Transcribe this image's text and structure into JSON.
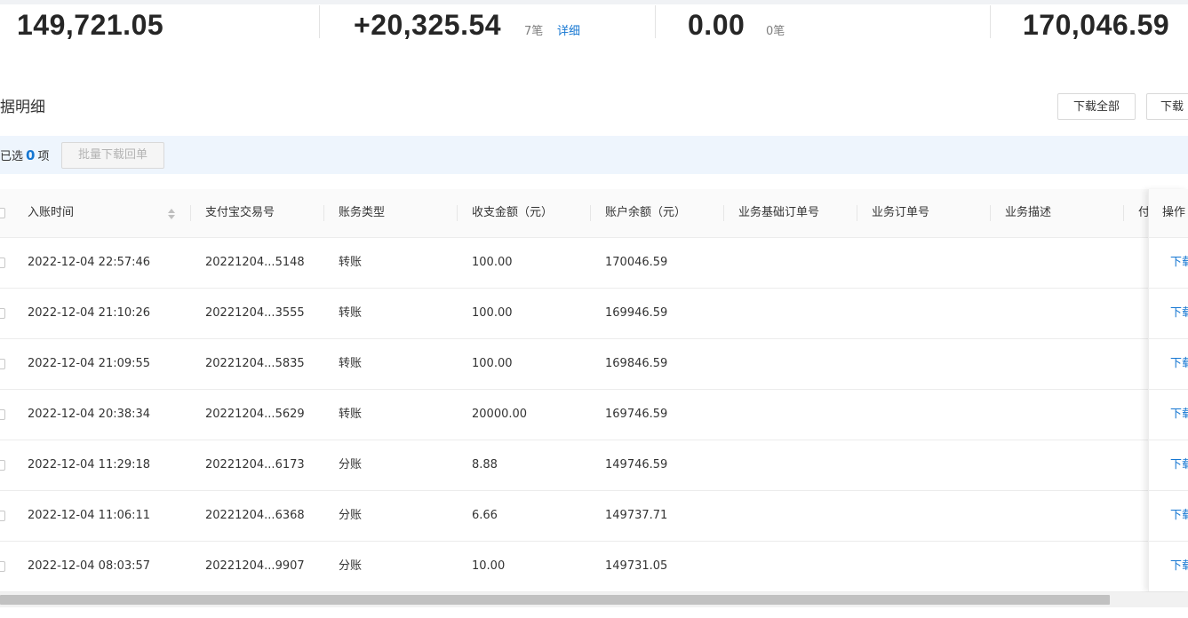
{
  "summary": {
    "stats": [
      {
        "value": "149,721.05"
      },
      {
        "value": "+20,325.54",
        "count": "7笔",
        "link": "详细"
      },
      {
        "value": "0.00",
        "count": "0笔"
      },
      {
        "value": "170,046.59"
      }
    ]
  },
  "section": {
    "title": "据明细",
    "download_all": "下载全部",
    "download_partial": "下载"
  },
  "selection": {
    "prefix": "已选",
    "count": "0",
    "suffix": "项",
    "batch_button": "批量下载回单"
  },
  "table": {
    "columns": [
      "入账时间",
      "支付宝交易号",
      "账务类型",
      "收支金额（元）",
      "账户余额（元）",
      "业务基础订单号",
      "业务订单号",
      "业务描述",
      "付"
    ],
    "action_column": "操作",
    "action_label": "下载",
    "rows": [
      {
        "time": "2022-12-04 22:57:46",
        "trade_no": "20221204...5148",
        "type": "转账",
        "amount": "100.00",
        "balance": "170046.59"
      },
      {
        "time": "2022-12-04 21:10:26",
        "trade_no": "20221204...3555",
        "type": "转账",
        "amount": "100.00",
        "balance": "169946.59"
      },
      {
        "time": "2022-12-04 21:09:55",
        "trade_no": "20221204...5835",
        "type": "转账",
        "amount": "100.00",
        "balance": "169846.59"
      },
      {
        "time": "2022-12-04 20:38:34",
        "trade_no": "20221204...5629",
        "type": "转账",
        "amount": "20000.00",
        "balance": "169746.59"
      },
      {
        "time": "2022-12-04 11:29:18",
        "trade_no": "20221204...6173",
        "type": "分账",
        "amount": "8.88",
        "balance": "149746.59"
      },
      {
        "time": "2022-12-04 11:06:11",
        "trade_no": "20221204...6368",
        "type": "分账",
        "amount": "6.66",
        "balance": "149737.71"
      },
      {
        "time": "2022-12-04 08:03:57",
        "trade_no": "20221204...9907",
        "type": "分账",
        "amount": "10.00",
        "balance": "149731.05"
      }
    ]
  },
  "colors": {
    "accent": "#1677d2",
    "selection_bar": "#eef5fd",
    "header_bg": "#fafafa"
  }
}
